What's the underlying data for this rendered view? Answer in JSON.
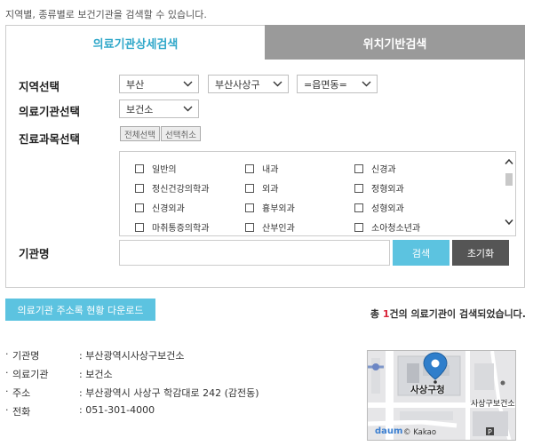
{
  "intro": "지역별, 종류별로 보건기관을 검색할 수 있습니다.",
  "tabs": {
    "detail": "의료기관상세검색",
    "location": "위치기반검색"
  },
  "form": {
    "region_label": "지역선택",
    "region_city": "부산",
    "region_district": "부산사상구",
    "region_town": "=읍면동=",
    "facility_label": "의료기관선택",
    "facility_value": "보건소",
    "dept_label": "진료과목선택",
    "select_all": "전체선택",
    "deselect_all": "선택취소",
    "departments": [
      [
        "일반의",
        "내과",
        "신경과"
      ],
      [
        "정신건강의학과",
        "외과",
        "정형외과"
      ],
      [
        "신경외과",
        "흉부외과",
        "성형외과"
      ],
      [
        "마취통증의학과",
        "산부인과",
        "소아청소년과"
      ]
    ],
    "name_label": "기관명",
    "name_value": "",
    "search_button": "검색",
    "reset_button": "초기화"
  },
  "results": {
    "download_button": "의료기관 주소록 현황 다운로드",
    "count_prefix": "총 ",
    "count_number": "1",
    "count_suffix": "건의 의료기관이 검색되었습니다."
  },
  "detail": {
    "rows": [
      {
        "key": "기관명",
        "value": ": 부산광역시사상구보건소"
      },
      {
        "key": "의료기관",
        "value": ": 보건소"
      },
      {
        "key": "주소",
        "value": ": 부산광역시 사상구 학감대로 242 (감전동)"
      },
      {
        "key": "전화",
        "value": ": 051-301-4000"
      }
    ]
  },
  "map": {
    "place_label": "사상구청",
    "poi_label": "사상구보건소",
    "brand": "daum",
    "copyright": "© Kakao",
    "marker_color": "#2f7ecb"
  },
  "colors": {
    "accent": "#5cc3e0",
    "tab_active_text": "#2fa7c9",
    "count_number": "#d9263a"
  }
}
